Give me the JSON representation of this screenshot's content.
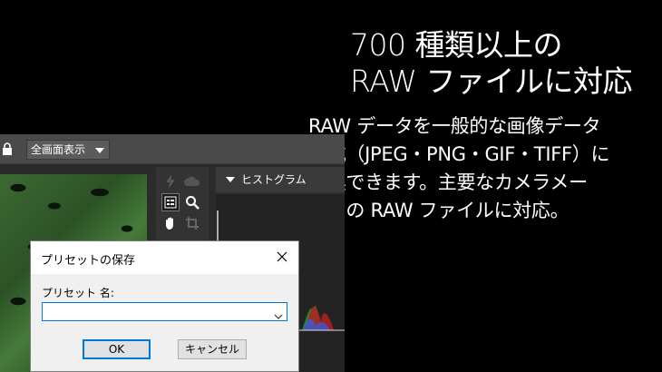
{
  "headline": {
    "line1": "700 種類以上の",
    "line2": "RAW ファイルに対応"
  },
  "description": {
    "lines": [
      "RAW データを一般的な画像データ",
      "形式（JPEG・PNG・GIF・TIFF）に",
      "変換できます。主要なカメラメー",
      "カーの RAW ファイルに対応。"
    ]
  },
  "app": {
    "view_select": "全画面表示",
    "panel_title": "ヒストグラム",
    "icons": [
      "lock-icon",
      "flash-icon",
      "cloud-icon",
      "list-icon",
      "zoom-icon",
      "hand-icon",
      "crop-icon"
    ]
  },
  "dialog": {
    "title": "プリセットの保存",
    "field_label": "プリセット 名:",
    "field_value": "",
    "ok_label": "OK",
    "cancel_label": "キャンセル"
  },
  "colors": {
    "background": "#000000",
    "accent": "#0078d7",
    "toolbar": "#4a4a4a"
  }
}
